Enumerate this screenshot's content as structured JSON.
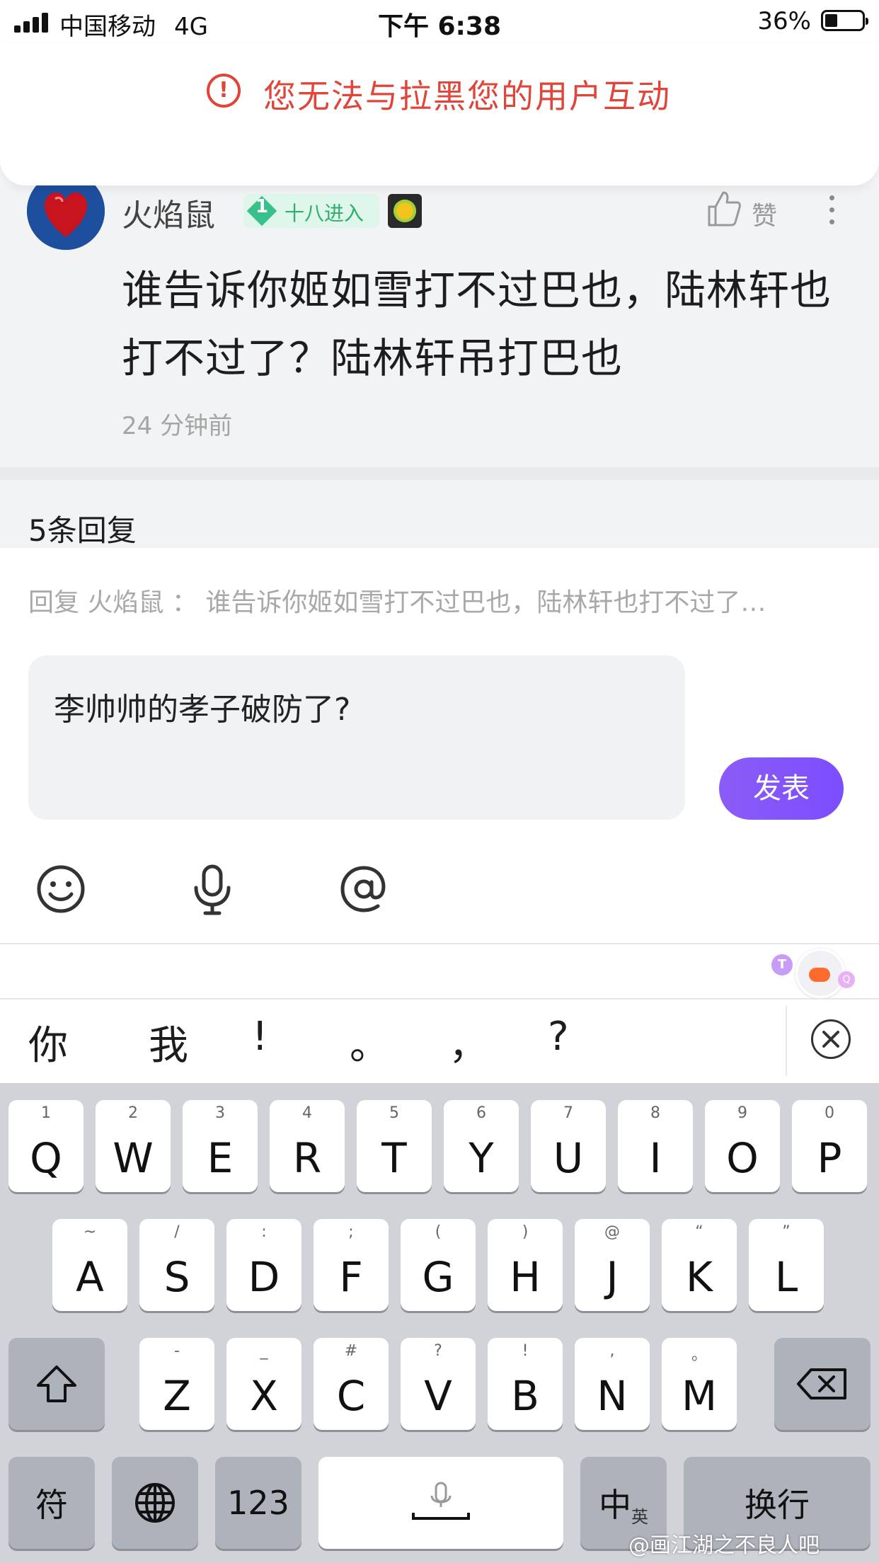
{
  "status_bar": {
    "carrier": "中国移动",
    "network": "4G",
    "time": "下午 6:38",
    "battery_percent": "36%"
  },
  "alert": {
    "icon": "exclamation-circle-icon",
    "message": "您无法与拉黑您的用户互动",
    "color": "#e0453a"
  },
  "post": {
    "username": "火焰鼠",
    "level_number": "1",
    "level_title": "十八进入",
    "like_label": "赞",
    "content": "谁告诉你姬如雪打不过巴也，陆林轩也打不过了？陆林轩吊打巴也",
    "time": "24 分钟前"
  },
  "replies": {
    "title": "5条回复"
  },
  "reply_box": {
    "reply_to": "回复 火焰鼠 ：  谁告诉你姬如雪打不过巴也，陆林轩也打不过了…",
    "input_value": "李帅帅的孝子破防了?",
    "send_label": "发表",
    "send_color": "#8b5cf6",
    "tools": [
      "emoji-icon",
      "microphone-icon",
      "at-icon"
    ]
  },
  "mascot": {
    "badge_left": "T",
    "badge_right": "Q"
  },
  "suggestions": [
    "你",
    "我",
    "!",
    "。",
    "，",
    "?"
  ],
  "keyboard": {
    "row1": [
      {
        "key": "Q",
        "sub": "1"
      },
      {
        "key": "W",
        "sub": "2"
      },
      {
        "key": "E",
        "sub": "3"
      },
      {
        "key": "R",
        "sub": "4"
      },
      {
        "key": "T",
        "sub": "5"
      },
      {
        "key": "Y",
        "sub": "6"
      },
      {
        "key": "U",
        "sub": "7"
      },
      {
        "key": "I",
        "sub": "8"
      },
      {
        "key": "O",
        "sub": "9"
      },
      {
        "key": "P",
        "sub": "0"
      }
    ],
    "row2": [
      {
        "key": "A",
        "sub": "~"
      },
      {
        "key": "S",
        "sub": "/"
      },
      {
        "key": "D",
        "sub": ":"
      },
      {
        "key": "F",
        "sub": ";"
      },
      {
        "key": "G",
        "sub": "("
      },
      {
        "key": "H",
        "sub": ")"
      },
      {
        "key": "J",
        "sub": "@"
      },
      {
        "key": "K",
        "sub": "“"
      },
      {
        "key": "L",
        "sub": "”"
      }
    ],
    "row3": [
      {
        "key": "Z",
        "sub": "-"
      },
      {
        "key": "X",
        "sub": "_"
      },
      {
        "key": "C",
        "sub": "#"
      },
      {
        "key": "V",
        "sub": "?"
      },
      {
        "key": "B",
        "sub": "!"
      },
      {
        "key": "N",
        "sub": ","
      },
      {
        "key": "M",
        "sub": "。"
      }
    ],
    "symbols_label": "符",
    "numbers_label": "123",
    "lang_label": "中",
    "lang_sub": "英",
    "return_label": "换行"
  },
  "watermark": "@画江湖之不良人吧"
}
